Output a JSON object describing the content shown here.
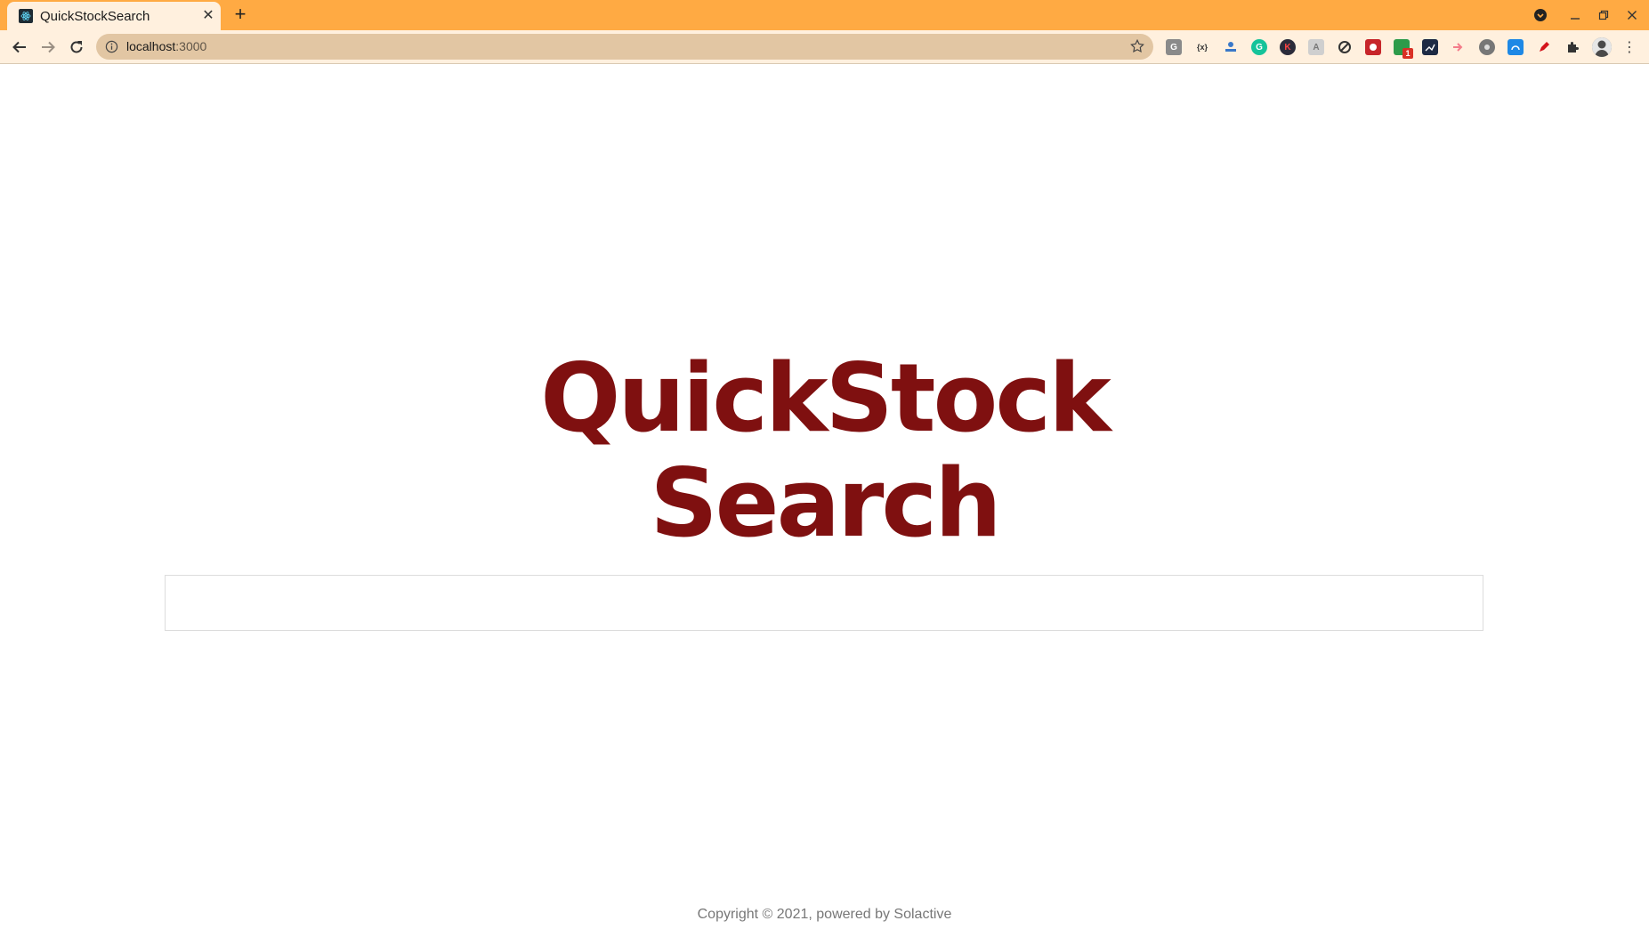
{
  "browser": {
    "tab": {
      "title": "QuickStockSearch"
    },
    "url": {
      "host": "localhost",
      "port": ":3000"
    }
  },
  "page": {
    "title_line1": "QuickStock",
    "title_line2": "Search",
    "search": {
      "value": "",
      "placeholder": ""
    },
    "footer": "Copyright © 2021, powered by Solactive"
  },
  "colors": {
    "tabstrip": "#ffaa43",
    "toolbar": "#fff0de",
    "omnibox": "#e2c6a3",
    "title": "#7f1010"
  },
  "extensions": [
    {
      "name": "google-translate-extension-icon",
      "glyph": "G"
    },
    {
      "name": "json-formatter-extension-icon",
      "glyph": "{x}"
    },
    {
      "name": "stamp-extension-icon",
      "glyph": ""
    },
    {
      "name": "grammarly-extension-icon",
      "glyph": "G"
    },
    {
      "name": "k-extension-icon",
      "glyph": "K"
    },
    {
      "name": "translate-extension-icon",
      "glyph": "A"
    },
    {
      "name": "refresh-extension-icon",
      "glyph": ""
    },
    {
      "name": "red-extension-icon",
      "glyph": ""
    },
    {
      "name": "spreadsheet-extension-icon",
      "glyph": "1"
    },
    {
      "name": "analytics-extension-icon",
      "glyph": ""
    },
    {
      "name": "arrow-extension-icon",
      "glyph": ""
    },
    {
      "name": "circle-extension-icon",
      "glyph": ""
    },
    {
      "name": "meter-extension-icon",
      "glyph": ""
    },
    {
      "name": "pen-extension-icon",
      "glyph": ""
    },
    {
      "name": "puzzle-extensions-icon",
      "glyph": ""
    }
  ]
}
